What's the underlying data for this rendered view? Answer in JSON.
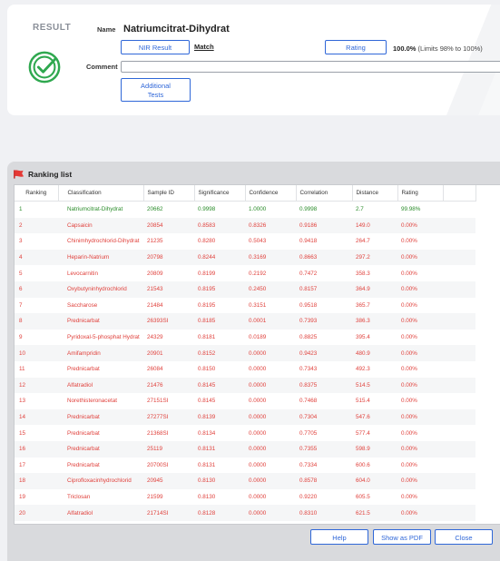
{
  "result": {
    "title": "RESULT",
    "name_label": "Name",
    "name_value": "Natriumcitrat-Dihydrat",
    "nir_result_label": "NIR Result",
    "match_label": "Match",
    "rating_button_label": "Rating",
    "rating_percent": "100.0%",
    "rating_limits": " (Limits 98% to 100%)",
    "comment_label": "Comment",
    "comment_value": "",
    "additional_tests_line1": "Additional",
    "additional_tests_line2": "Tests",
    "status_color": "#2fa84f",
    "status_icon": "check-badge-icon"
  },
  "ranking": {
    "title": "Ranking list",
    "icon": "flag-icon",
    "columns": [
      "Ranking",
      "Classification",
      "Sample ID",
      "Significance",
      "Confidence",
      "Correlation",
      "Distance",
      "Rating"
    ],
    "rows": [
      {
        "rank": "1",
        "classification": "Natriumcitrat-Dihydrat",
        "sample_id": "20662",
        "significance": "0.9998",
        "confidence": "1.0000",
        "correlation": "0.9998",
        "distance": "2.7",
        "rating": "99.98%",
        "pass": true
      },
      {
        "rank": "2",
        "classification": "Capsaicin",
        "sample_id": "20854",
        "significance": "0.8583",
        "confidence": "0.8326",
        "correlation": "0.9186",
        "distance": "149.0",
        "rating": "0.00%",
        "pass": false
      },
      {
        "rank": "3",
        "classification": "Chinimhydrochlorid-Dihydrat",
        "sample_id": "21235",
        "significance": "0.8280",
        "confidence": "0.5043",
        "correlation": "0.9418",
        "distance": "264.7",
        "rating": "0.00%",
        "pass": false
      },
      {
        "rank": "4",
        "classification": "Heparin-Natrium",
        "sample_id": "20798",
        "significance": "0.8244",
        "confidence": "0.3169",
        "correlation": "0.8663",
        "distance": "297.2",
        "rating": "0.00%",
        "pass": false
      },
      {
        "rank": "5",
        "classification": "Levocarnitin",
        "sample_id": "20809",
        "significance": "0.8199",
        "confidence": "0.2192",
        "correlation": "0.7472",
        "distance": "358.3",
        "rating": "0.00%",
        "pass": false
      },
      {
        "rank": "6",
        "classification": "Oxybutyninhydrochlorid",
        "sample_id": "21543",
        "significance": "0.8195",
        "confidence": "0.2450",
        "correlation": "0.8157",
        "distance": "364.9",
        "rating": "0.00%",
        "pass": false
      },
      {
        "rank": "7",
        "classification": "Saccharose",
        "sample_id": "21484",
        "significance": "0.8195",
        "confidence": "0.3151",
        "correlation": "0.9518",
        "distance": "365.7",
        "rating": "0.00%",
        "pass": false
      },
      {
        "rank": "8",
        "classification": "Prednicarbat",
        "sample_id": "26393SI",
        "significance": "0.8185",
        "confidence": "0.0001",
        "correlation": "0.7393",
        "distance": "386.3",
        "rating": "0.00%",
        "pass": false
      },
      {
        "rank": "9",
        "classification": "Pyridoxal-5-phosphat Hydrat",
        "sample_id": "24329",
        "significance": "0.8181",
        "confidence": "0.0189",
        "correlation": "0.8825",
        "distance": "395.4",
        "rating": "0.00%",
        "pass": false
      },
      {
        "rank": "10",
        "classification": "Amifampridin",
        "sample_id": "20901",
        "significance": "0.8152",
        "confidence": "0.0000",
        "correlation": "0.9423",
        "distance": "480.9",
        "rating": "0.00%",
        "pass": false
      },
      {
        "rank": "11",
        "classification": "Prednicarbat",
        "sample_id": "26084",
        "significance": "0.8150",
        "confidence": "0.0000",
        "correlation": "0.7343",
        "distance": "492.3",
        "rating": "0.00%",
        "pass": false
      },
      {
        "rank": "12",
        "classification": "Alfatradiol",
        "sample_id": "21476",
        "significance": "0.8145",
        "confidence": "0.0000",
        "correlation": "0.8375",
        "distance": "514.5",
        "rating": "0.00%",
        "pass": false
      },
      {
        "rank": "13",
        "classification": "Norethisteronacetat",
        "sample_id": "27151SI",
        "significance": "0.8145",
        "confidence": "0.0000",
        "correlation": "0.7468",
        "distance": "515.4",
        "rating": "0.00%",
        "pass": false
      },
      {
        "rank": "14",
        "classification": "Prednicarbat",
        "sample_id": "27277SI",
        "significance": "0.8139",
        "confidence": "0.0000",
        "correlation": "0.7304",
        "distance": "547.6",
        "rating": "0.00%",
        "pass": false
      },
      {
        "rank": "15",
        "classification": "Prednicarbat",
        "sample_id": "21368SI",
        "significance": "0.8134",
        "confidence": "0.0000",
        "correlation": "0.7705",
        "distance": "577.4",
        "rating": "0.00%",
        "pass": false
      },
      {
        "rank": "16",
        "classification": "Prednicarbat",
        "sample_id": "25119",
        "significance": "0.8131",
        "confidence": "0.0000",
        "correlation": "0.7355",
        "distance": "598.9",
        "rating": "0.00%",
        "pass": false
      },
      {
        "rank": "17",
        "classification": "Prednicarbat",
        "sample_id": "20700SI",
        "significance": "0.8131",
        "confidence": "0.0000",
        "correlation": "0.7334",
        "distance": "600.6",
        "rating": "0.00%",
        "pass": false
      },
      {
        "rank": "18",
        "classification": "Ciprofloxacinhydrochlorid",
        "sample_id": "20945",
        "significance": "0.8130",
        "confidence": "0.0000",
        "correlation": "0.8578",
        "distance": "604.0",
        "rating": "0.00%",
        "pass": false
      },
      {
        "rank": "19",
        "classification": "Triclosan",
        "sample_id": "21599",
        "significance": "0.8130",
        "confidence": "0.0000",
        "correlation": "0.9220",
        "distance": "605.5",
        "rating": "0.00%",
        "pass": false
      },
      {
        "rank": "20",
        "classification": "Alfatradiol",
        "sample_id": "21714SI",
        "significance": "0.8128",
        "confidence": "0.0000",
        "correlation": "0.8310",
        "distance": "621.5",
        "rating": "0.00%",
        "pass": false
      }
    ],
    "pass_color": "#2a8c2a",
    "fail_color": "#e0413c"
  },
  "footer": {
    "help_label": "Help",
    "pdf_label": "Show as PDF",
    "close_label": "Close"
  }
}
